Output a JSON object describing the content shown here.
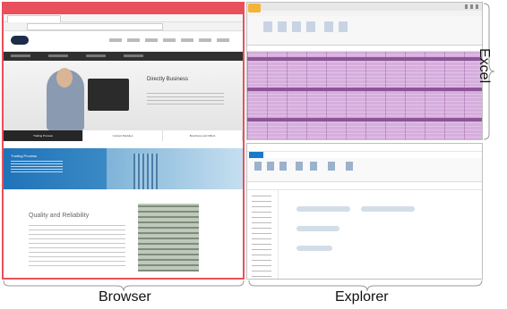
{
  "labels": {
    "browser": "Browser",
    "explorer": "Explorer",
    "excel": "Excel"
  },
  "browser": {
    "hero_title": "Directly Business",
    "features": [
      "Trading Process",
      "Content Modules",
      "Brochures and Offers"
    ],
    "banner_title": "Trading Process",
    "content_title": "Quality and Reliability"
  },
  "colors": {
    "browser_accent": "#e8505b",
    "excel_grid": "#d6aedd",
    "explorer_accent": "#1979ca"
  }
}
